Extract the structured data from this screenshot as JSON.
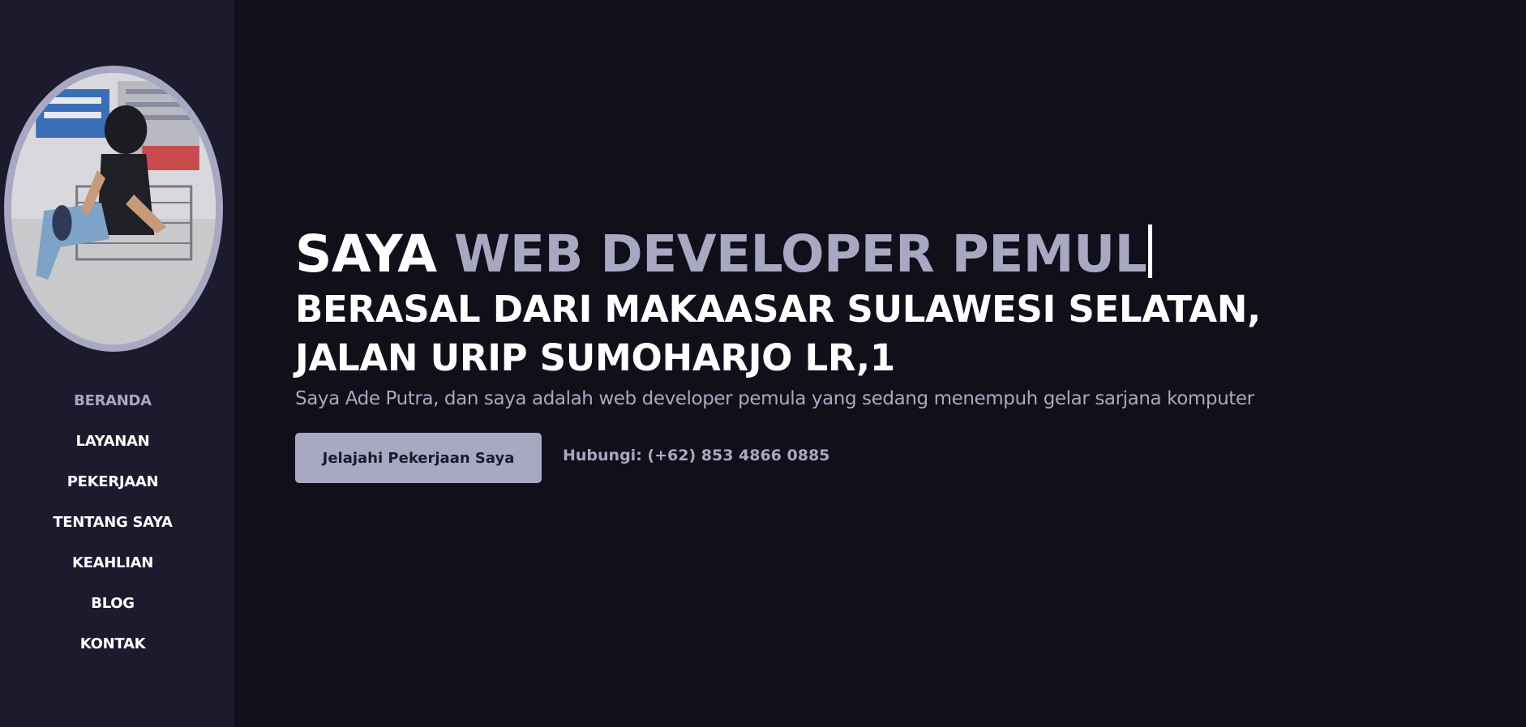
{
  "sidebar": {
    "nav": [
      {
        "label": "BERANDA",
        "active": true
      },
      {
        "label": "LAYANAN"
      },
      {
        "label": "PEKERJAAN"
      },
      {
        "label": "TENTANG SAYA"
      },
      {
        "label": "KEAHLIAN"
      },
      {
        "label": "BLOG"
      },
      {
        "label": "KONTAK"
      }
    ]
  },
  "hero": {
    "headline_prefix": "SAYA",
    "headline_typed": "WEB DEVELOPER PEMUL",
    "subheadline_line1": "BERASAL DARI MAKAASAR SULAWESI SELATAN,",
    "subheadline_line2": "JALAN URIP SUMOHARJO LR,1",
    "intro": "Saya Ade Putra, dan saya adalah web developer pemula yang sedang menempuh gelar sarjana komputer",
    "cta_label": "Jelajahi Pekerjaan Saya",
    "contact": "Hubungi: (+62) 853 4866 0885"
  },
  "colors": {
    "background": "#100f1a",
    "sidebar": "#1c1a2d",
    "accent": "#a9a8c2",
    "text": "#ffffff"
  }
}
